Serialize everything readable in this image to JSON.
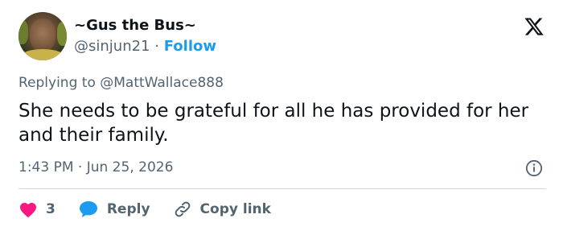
{
  "user": {
    "display_name": "~Gus the Bus~",
    "handle": "@sinjun21",
    "separator": "·",
    "follow_label": "Follow"
  },
  "reply": {
    "prefix": "Replying to",
    "mention": "@MattWallace888"
  },
  "tweet": {
    "text": "She needs to be grateful for all he has provided for her and their family."
  },
  "meta": {
    "time": "1:43 PM",
    "separator": "·",
    "date": "Jun 25, 2026"
  },
  "actions": {
    "like_count": "3",
    "reply_label": "Reply",
    "copy_label": "Copy link"
  },
  "icons": {
    "logo": "x-logo-icon",
    "info": "info-icon",
    "like": "heart-icon",
    "reply": "chat-bubble-icon",
    "copy": "link-icon"
  },
  "colors": {
    "follow": "#1d9bf0",
    "like": "#f91880",
    "reply": "#1d9bf0",
    "muted": "#536471",
    "text": "#0f1419"
  }
}
